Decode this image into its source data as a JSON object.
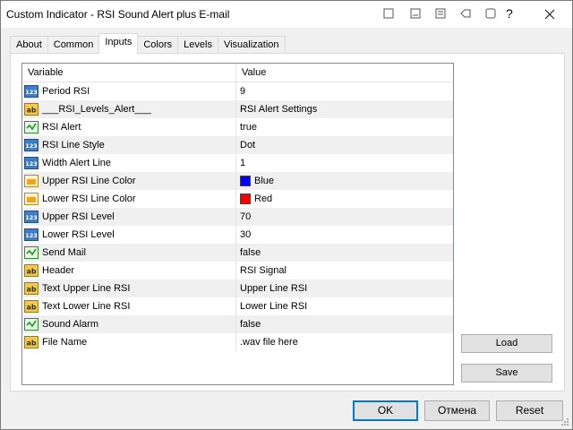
{
  "window": {
    "title": "Custom Indicator - RSI Sound Alert plus E-mail",
    "help_label": "?"
  },
  "tabs": [
    {
      "label": "About"
    },
    {
      "label": "Common"
    },
    {
      "label": "Inputs"
    },
    {
      "label": "Colors"
    },
    {
      "label": "Levels"
    },
    {
      "label": "Visualization"
    }
  ],
  "grid": {
    "header_variable": "Variable",
    "header_value": "Value",
    "rows": [
      {
        "variable": "Period RSI",
        "value": "9",
        "type": "int"
      },
      {
        "variable": "___RSI_Levels_Alert___",
        "value": "RSI Alert Settings",
        "type": "string"
      },
      {
        "variable": "RSI Alert",
        "value": "true",
        "type": "bool"
      },
      {
        "variable": "RSI Line Style",
        "value": "Dot",
        "type": "int"
      },
      {
        "variable": "Width Alert Line",
        "value": "1",
        "type": "int"
      },
      {
        "variable": "Upper RSI Line Color",
        "value": "Blue",
        "type": "color",
        "color": "#0000ff"
      },
      {
        "variable": "Lower RSI Line Color",
        "value": "Red",
        "type": "color",
        "color": "#ff0000"
      },
      {
        "variable": "Upper RSI Level",
        "value": "70",
        "type": "int"
      },
      {
        "variable": "Lower RSI Level",
        "value": "30",
        "type": "int"
      },
      {
        "variable": "Send Mail",
        "value": "false",
        "type": "bool"
      },
      {
        "variable": "Header",
        "value": "RSI Signal",
        "type": "string"
      },
      {
        "variable": "Text Upper Line RSI",
        "value": "Upper Line RSI",
        "type": "string"
      },
      {
        "variable": "Text Lower Line RSI",
        "value": "Lower Line RSI",
        "type": "string"
      },
      {
        "variable": "Sound Alarm",
        "value": "false",
        "type": "bool"
      },
      {
        "variable": "File Name",
        "value": ".wav file here",
        "type": "string"
      }
    ]
  },
  "side_buttons": {
    "load": "Load",
    "save": "Save"
  },
  "footer": {
    "ok": "OK",
    "cancel": "Отмена",
    "reset": "Reset"
  },
  "colors": {
    "accent": "#0078d7",
    "row_alt": "#f0f0f0"
  }
}
